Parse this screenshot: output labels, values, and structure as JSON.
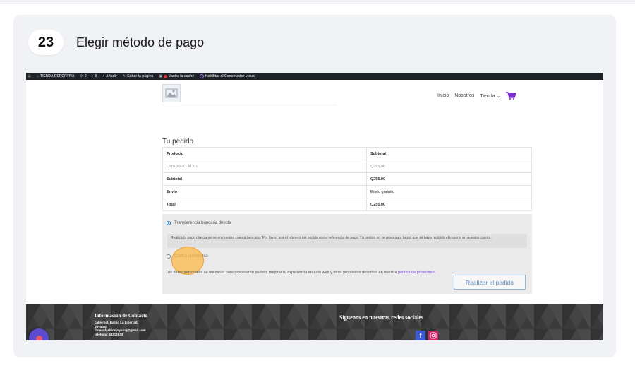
{
  "step": {
    "number": "23",
    "title": "Elegir método de pago"
  },
  "admin_bar": {
    "site_name": "TIENDA DEPORTIVA",
    "updates": "2",
    "comments": "0",
    "new": "Añadir",
    "edit": "Editar la página",
    "purge": "Vaciar la caché",
    "builder": "Habilitar el Constructor visual"
  },
  "nav": {
    "items": [
      "Inicio",
      "Nosotros",
      "Tienda ⌄"
    ]
  },
  "order": {
    "title": "Tu pedido",
    "headers": [
      "Producto",
      "Subtotal"
    ],
    "rows": [
      [
        "Licra 2002 - M  × 1",
        "Q255.00"
      ],
      [
        "Subtotal",
        "Q255.00"
      ],
      [
        "Envío",
        "Envío gratuito"
      ],
      [
        "Total",
        "Q255.00"
      ]
    ]
  },
  "payment": {
    "option1": "Transferencia bancaria directa",
    "option1_desc": "Realiza tu pago directamente en nuestra cuenta bancaria. Por favor, usa el número del pedido como referencia de pago. Tu pedido no se procesará hasta que se haya recibido el importe en nuestra cuenta.",
    "option2": "Contra reembolso",
    "privacy_text": "Tus datos personales se utilizarán para procesar tu pedido, mejorar tu experiencia en esta web y otros propósitos descritos en nuestra ",
    "privacy_link": "política de privacidad.",
    "place_order": "Realizar el pedido"
  },
  "footer": {
    "contact_title": "Información de Contacto",
    "address_1": "calle real, Barrio La Libertad,",
    "address_2": "Joyabaj",
    "email": "fitnessfashionjoyabaj@gmail.com",
    "phone": "telefono: 44212633",
    "social_title": "Síguenos en nuestras redes sociales"
  },
  "colors": {
    "accent": "#2271b1",
    "highlight": "#fcba49",
    "footer_bg": "#3b3b3b",
    "facebook": "#3b5bd6",
    "instagram": "#d6236a",
    "chat": "#5a4bd1"
  }
}
